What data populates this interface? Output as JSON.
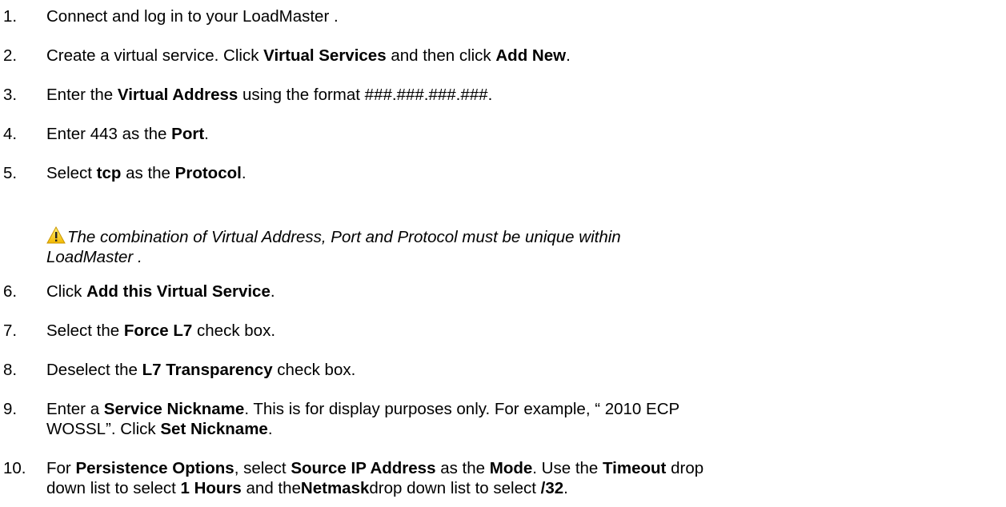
{
  "steps": [
    {
      "num": "1.",
      "parts": [
        {
          "t": "Connect and log in to your LoadMaster  ."
        }
      ]
    },
    {
      "num": "2.",
      "parts": [
        {
          "t": "Create a virtual service. Click "
        },
        {
          "t": "Virtual Services",
          "b": true
        },
        {
          "t": " and then click "
        },
        {
          "t": "Add New",
          "b": true
        },
        {
          "t": "."
        }
      ]
    },
    {
      "num": "3.",
      "parts": [
        {
          "t": "Enter the "
        },
        {
          "t": "Virtual Address",
          "b": true
        },
        {
          "t": " using the format ###.###.###.###."
        }
      ]
    },
    {
      "num": "4.",
      "parts": [
        {
          "t": "Enter 443 as the "
        },
        {
          "t": "Port",
          "b": true
        },
        {
          "t": "."
        }
      ]
    },
    {
      "num": "5.",
      "parts": [
        {
          "t": "Select "
        },
        {
          "t": "tcp",
          "b": true
        },
        {
          "t": " as the "
        },
        {
          "t": "Protocol",
          "b": true
        },
        {
          "t": "."
        }
      ]
    },
    {
      "num": "6.",
      "parts": [
        {
          "t": "Click "
        },
        {
          "t": "Add this Virtual Service",
          "b": true
        },
        {
          "t": "."
        }
      ]
    },
    {
      "num": "7.",
      "parts": [
        {
          "t": "Select the "
        },
        {
          "t": "Force L7",
          "b": true
        },
        {
          "t": " check box."
        }
      ]
    },
    {
      "num": "8.",
      "parts": [
        {
          "t": "Deselect the "
        },
        {
          "t": "L7 Transparency",
          "b": true
        },
        {
          "t": " check box."
        }
      ]
    },
    {
      "num": "9.",
      "parts": [
        {
          "t": "Enter a "
        },
        {
          "t": "Service Nickname",
          "b": true
        },
        {
          "t": ". This is for display purposes only. For example, “ 2010 ECP"
        }
      ]
    },
    {
      "num": "",
      "parts": [
        {
          "t": "WOSSL”. Click "
        },
        {
          "t": "Set Nickname",
          "b": true
        },
        {
          "t": "."
        }
      ]
    },
    {
      "num": "10.",
      "parts": [
        {
          "t": "For "
        },
        {
          "t": "Persistence Options",
          "b": true
        },
        {
          "t": ", select "
        },
        {
          "t": "Source IP Address",
          "b": true
        },
        {
          "t": " as the "
        },
        {
          "t": "Mode",
          "b": true
        },
        {
          "t": ". Use the "
        },
        {
          "t": "Timeout",
          "b": true
        },
        {
          "t": " drop"
        }
      ]
    },
    {
      "num": "",
      "parts": [
        {
          "t": "down list to select "
        },
        {
          "t": "1 Hours",
          "b": true
        },
        {
          "t": " and the"
        },
        {
          "t": "Netmask",
          "b": true
        },
        {
          "t": "drop down list to select "
        },
        {
          "t": "/32",
          "b": true
        },
        {
          "t": "."
        }
      ]
    }
  ],
  "warning": {
    "icon": "warning-icon",
    "icon_color": "#f2c200",
    "line1": "The combination of Virtual Address, Port and Protocol must be unique within",
    "line2": "LoadMaster ."
  }
}
